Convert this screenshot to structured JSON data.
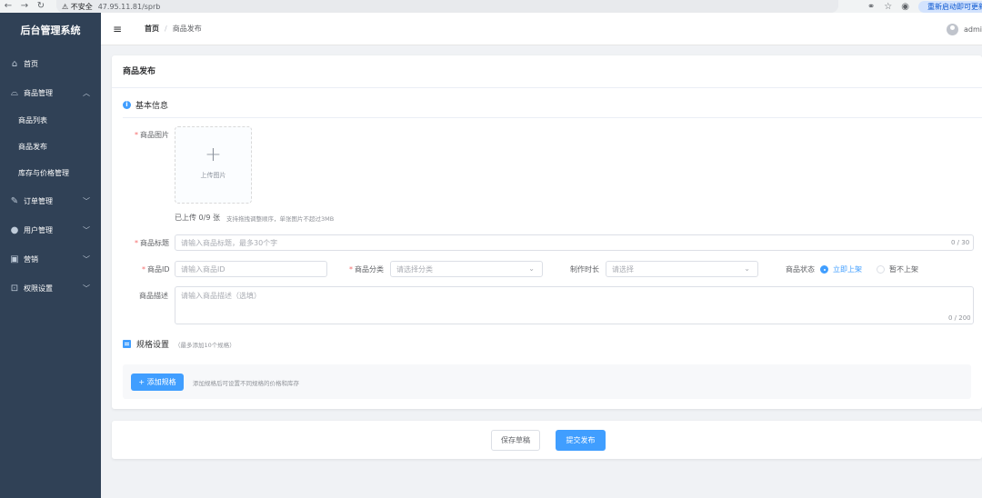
{
  "browser": {
    "security_label": "不安全",
    "url": "47.95.11.81/sprb",
    "update_label": "重新启动即可更新"
  },
  "sidebar": {
    "brand": "后台管理系统",
    "items": [
      {
        "label": "首页",
        "icon": "home-icon"
      },
      {
        "label": "商品管理",
        "icon": "bag-icon",
        "expanded": true,
        "children": [
          {
            "label": "商品列表"
          },
          {
            "label": "商品发布"
          },
          {
            "label": "库存与价格管理"
          }
        ]
      },
      {
        "label": "订单管理",
        "icon": "edit-icon"
      },
      {
        "label": "用户管理",
        "icon": "user-icon"
      },
      {
        "label": "营销",
        "icon": "gift-icon"
      },
      {
        "label": "权限设置",
        "icon": "lock-icon"
      }
    ],
    "bg_color": "#304156"
  },
  "header": {
    "breadcrumb": {
      "home": "首页",
      "separator": "/",
      "current": "商品发布"
    },
    "username": "admin"
  },
  "form": {
    "title": "商品发布",
    "basic_section": "基本信息",
    "image": {
      "label": "商品图片",
      "upload_text": "上传图片",
      "count": "已上传 0/9 张",
      "hint": "支持拖拽调整顺序，单张图片不超过3MB"
    },
    "title_field": {
      "label": "商品标题",
      "placeholder": "请输入商品标题，最多30个字",
      "counter": "0 / 30"
    },
    "id_field": {
      "label": "商品ID",
      "placeholder": "请输入商品ID"
    },
    "category": {
      "label": "商品分类",
      "placeholder": "请选择分类"
    },
    "duration": {
      "label": "制作时长",
      "placeholder": "请选择"
    },
    "status": {
      "label": "商品状态",
      "options": [
        "立即上架",
        "暂不上架"
      ],
      "selected": "立即上架"
    },
    "description": {
      "label": "商品描述",
      "placeholder": "请输入商品描述（选填）",
      "counter": "0 / 200"
    },
    "spec_section": "规格设置",
    "spec_note": "（最多添加10个规格）",
    "add_spec_button": "+ 添加规格",
    "spec_hint": "添加规格后可设置不同规格的价格和库存"
  },
  "actions": {
    "save_draft": "保存草稿",
    "submit": "提交发布"
  },
  "colors": {
    "primary": "#409eff",
    "required": "#f56c6c"
  }
}
